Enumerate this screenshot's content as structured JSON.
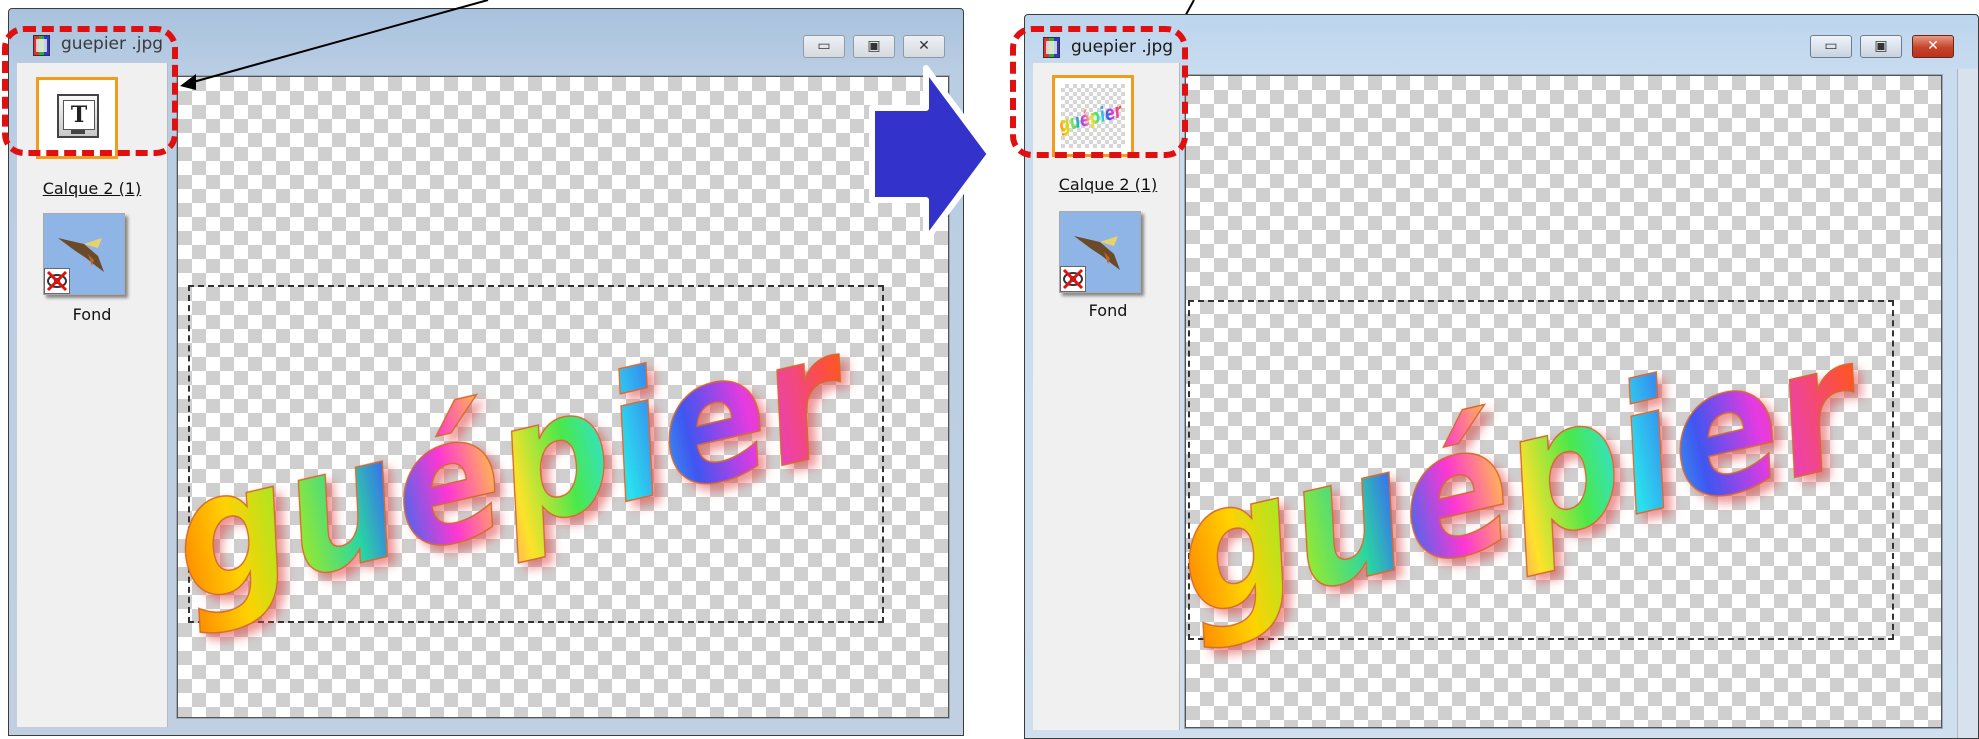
{
  "windows": [
    {
      "title": "guepier .jpg",
      "close_glyph": "✕",
      "layers": [
        {
          "name": "Calque 2 (1)",
          "thumbnail": "text-layer-icon"
        },
        {
          "name": "Fond",
          "thumbnail": "bird-photo"
        }
      ],
      "canvas_text": "guépier"
    },
    {
      "title": "guepier .jpg",
      "close_glyph": "✕",
      "layers": [
        {
          "name": "Calque 2 (1)",
          "thumbnail": "guepier-text-preview"
        },
        {
          "name": "Fond",
          "thumbnail": "bird-photo"
        }
      ],
      "thumb_text": "guépier",
      "canvas_text": "guépier"
    }
  ],
  "colors": {
    "highlight": "#e01010",
    "arrow": "#3333cc",
    "active_layer_border": "#f39b1c"
  }
}
